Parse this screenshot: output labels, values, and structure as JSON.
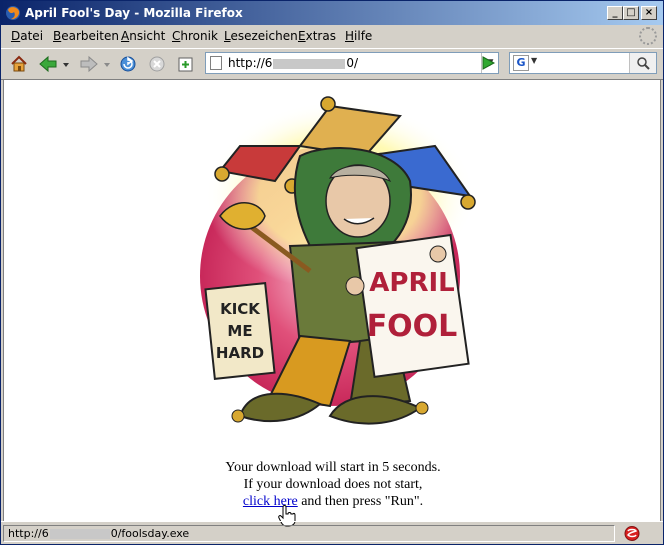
{
  "window": {
    "title": "April Fool's Day - Mozilla Firefox"
  },
  "menubar": {
    "items": [
      {
        "label": "Datei",
        "ul": "D",
        "rest": "atei"
      },
      {
        "label": "Bearbeiten",
        "ul": "B",
        "rest": "earbeiten"
      },
      {
        "label": "Ansicht",
        "ul": "A",
        "rest": "nsicht"
      },
      {
        "label": "Chronik",
        "ul": "C",
        "rest": "hronik"
      },
      {
        "label": "Lesezeichen",
        "ul": "L",
        "rest": "esezeichen"
      },
      {
        "label": "Extras",
        "ul": "E",
        "rest": "xtras"
      },
      {
        "label": "Hilfe",
        "ul": "H",
        "rest": "ilfe"
      }
    ]
  },
  "urlbar": {
    "prefix": "http://6",
    "suffix": "0/"
  },
  "search": {
    "engine": "G",
    "value": ""
  },
  "page": {
    "sign_left": [
      "KICK",
      "ME",
      "HARD"
    ],
    "sign_right": [
      "APRIL",
      "FOOL"
    ],
    "line1": "Your download will start in 5 seconds.",
    "line2": "If your download does not start,",
    "link": "click here",
    "line3_rest": " and then press \"Run\"."
  },
  "status": {
    "prefix": "http://6",
    "suffix": "0/foolsday.exe"
  },
  "colors": {
    "title_start": "#0a246a",
    "title_end": "#a6caf0",
    "link": "#0000cc",
    "sign_text": "#b0203a"
  }
}
